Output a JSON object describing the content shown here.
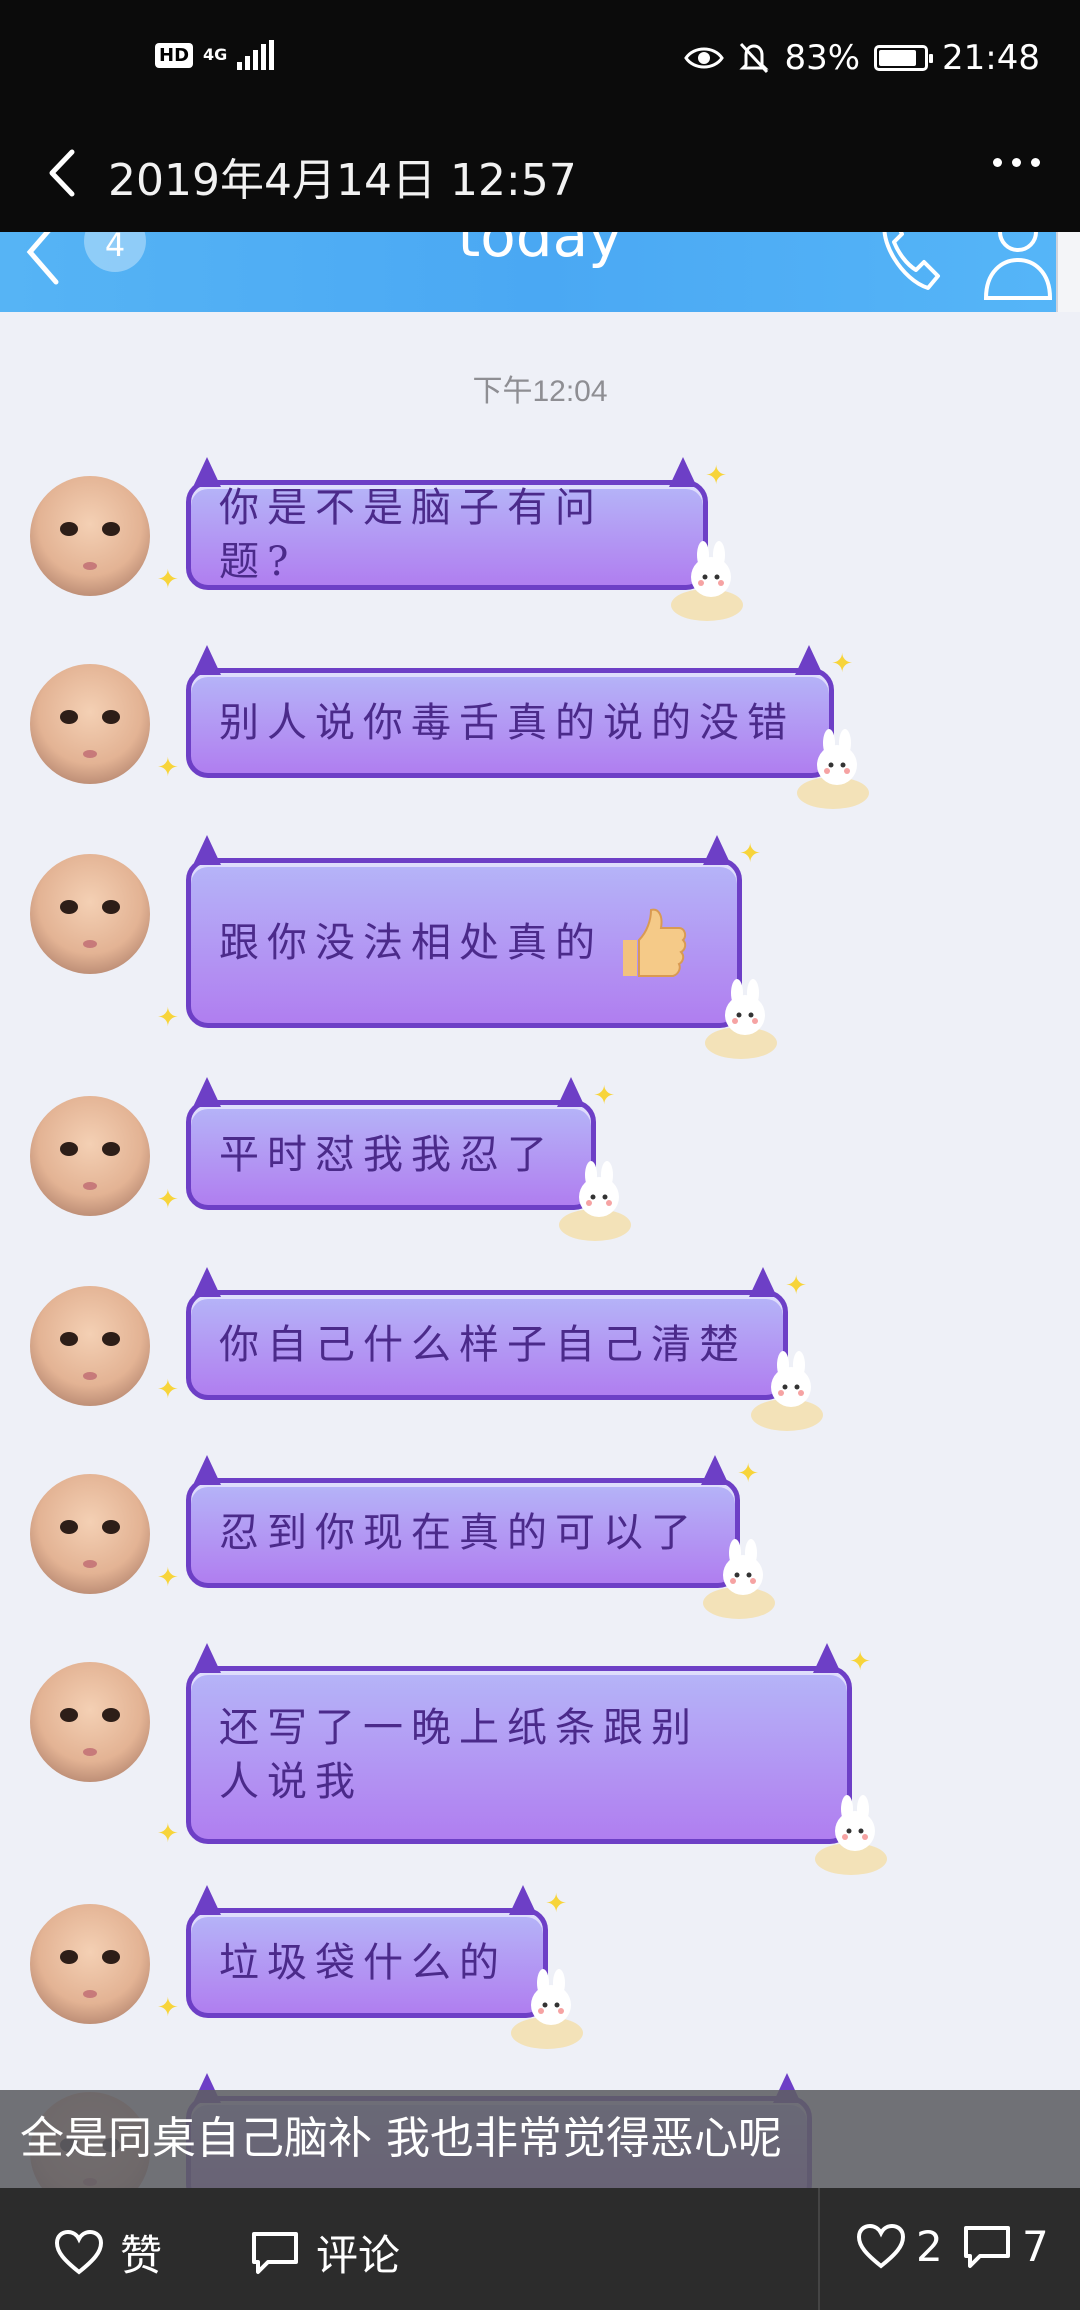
{
  "status_bar": {
    "hd": "HD",
    "network": "4G",
    "battery": "83%",
    "battery_level": 0.83,
    "time": "21:48"
  },
  "viewer": {
    "title": "2019年4月14日 12:57"
  },
  "chat_header": {
    "unread_count": "4",
    "title": "today"
  },
  "chat": {
    "timestamp": "下午12:04",
    "messages": [
      {
        "text": "你是不是脑子有问题?"
      },
      {
        "text": "别人说你毒舌真的说的没错"
      },
      {
        "text": "跟你没法相处真的"
      },
      {
        "text": "平时怼我我忍了"
      },
      {
        "text": "你自己什么样子自己清楚"
      },
      {
        "text": "忍到你现在真的可以了"
      },
      {
        "text": "还写了一晚上纸条跟别人说我"
      },
      {
        "text": "垃圾袋什么的"
      }
    ]
  },
  "caption": "全是同桌自己脑补  我也非常觉得恶心呢",
  "bottom_bar": {
    "like_label": "赞",
    "comment_label": "评论",
    "like_count": "2",
    "comment_count": "7"
  },
  "colors": {
    "bubble_border": "#6d3fc6",
    "bubble_text": "#4b2a8a",
    "qq_header": "#4aa8f3"
  }
}
